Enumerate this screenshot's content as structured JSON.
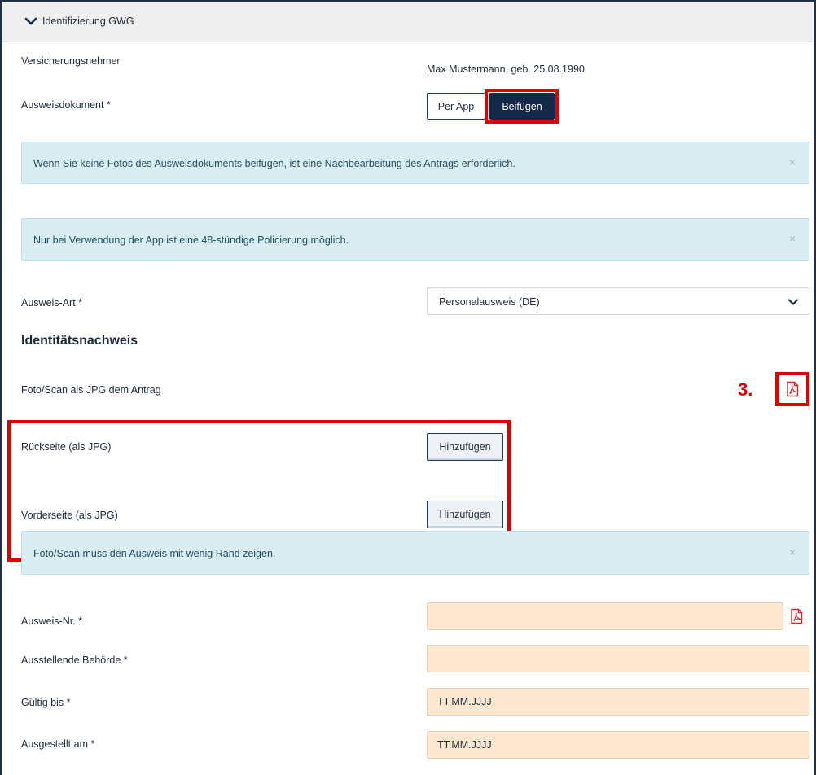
{
  "section": {
    "title": "Identifizierung GWG"
  },
  "policyholder": {
    "label": "Versicherungsnehmer",
    "value": "Max Mustermann, geb. 25.08.1990"
  },
  "id_document": {
    "label": "Ausweisdokument *",
    "per_app_label": "Per App",
    "attach_label": "Beifügen"
  },
  "alerts": {
    "no_photos": "Wenn Sie keine Fotos des Ausweisdokuments beifügen, ist eine Nachbearbeitung des Antrags erforderlich.",
    "app_only": "Nur bei Verwendung der App ist eine 48-stündige Policierung möglich.",
    "photo_hint": "Foto/Scan muss den Ausweis mit wenig Rand zeigen.",
    "close_symbol": "×"
  },
  "id_type": {
    "label": "Ausweis-Art *",
    "selected": "Personalausweis (DE)"
  },
  "proof": {
    "heading": "Identitätsnachweis",
    "photo_label": "Foto/Scan als JPG dem Antrag",
    "back_label": "Rückseite (als JPG)",
    "front_label": "Vorderseite (als JPG)",
    "add_label": "Hinzufügen"
  },
  "annotation": {
    "step_label": "3."
  },
  "fields": {
    "id_number_label": "Ausweis-Nr. *",
    "authority_label": "Ausstellende Behörde *",
    "valid_until_label": "Gültig bis *",
    "valid_until_placeholder": "TT.MM.JJJJ",
    "issued_on_label": "Ausgestellt am *",
    "issued_on_placeholder": "TT.MM.JJJJ"
  },
  "colors": {
    "primary": "#14294a",
    "info_bg": "#d9edf3",
    "field_bg": "#fde8cf",
    "annotation_red": "#e00000",
    "pdf_red": "#d4262c"
  },
  "icons": {
    "collapse": "chevron-down-icon",
    "select": "chevron-down-icon",
    "pdf": "pdf-icon",
    "close": "close-icon"
  }
}
